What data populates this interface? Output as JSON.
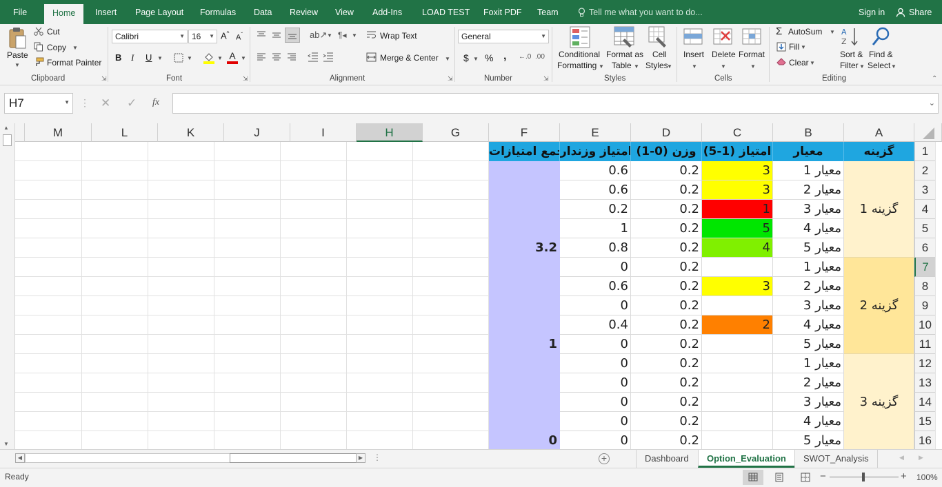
{
  "ribbon_tabs": [
    {
      "label": "File"
    },
    {
      "label": "Home"
    },
    {
      "label": "Insert"
    },
    {
      "label": "Page Layout"
    },
    {
      "label": "Formulas"
    },
    {
      "label": "Data"
    },
    {
      "label": "Review"
    },
    {
      "label": "View"
    },
    {
      "label": "Add-Ins"
    },
    {
      "label": "LOAD TEST"
    },
    {
      "label": "Foxit PDF"
    },
    {
      "label": "Team"
    }
  ],
  "tell_me": "Tell me what you want to do...",
  "sign_in": "Sign in",
  "share": "Share",
  "clipboard": {
    "paste": "Paste",
    "cut": "Cut",
    "copy": "Copy",
    "format_painter": "Format Painter",
    "label": "Clipboard"
  },
  "font": {
    "name": "Calibri",
    "size": "16",
    "bold": "B",
    "italic": "I",
    "underline": "U",
    "label": "Font"
  },
  "alignment": {
    "wrap_text": "Wrap Text",
    "merge_center": "Merge & Center",
    "label": "Alignment"
  },
  "number": {
    "format": "General",
    "currency": "$",
    "percent": "%",
    "comma": ",",
    "label": "Number"
  },
  "styles": {
    "conditional_l1": "Conditional",
    "conditional_l2": "Formatting",
    "format_table_l1": "Format as",
    "format_table_l2": "Table",
    "cell_styles_l1": "Cell",
    "cell_styles_l2": "Styles",
    "label": "Styles"
  },
  "cells": {
    "insert": "Insert",
    "delete": "Delete",
    "format": "Format",
    "label": "Cells"
  },
  "editing": {
    "autosum": "AutoSum",
    "fill": "Fill",
    "clear": "Clear",
    "sort_l1": "Sort &",
    "sort_l2": "Filter",
    "find_l1": "Find &",
    "find_l2": "Select",
    "label": "Editing"
  },
  "formula_bar": {
    "name_box": "H7",
    "fx": "fx",
    "content": ""
  },
  "columns": [
    "M",
    "L",
    "K",
    "J",
    "I",
    "H",
    "G",
    "F",
    "E",
    "D",
    "C",
    "B",
    "A"
  ],
  "selected_column": "H",
  "rows": [
    "1",
    "2",
    "3",
    "4",
    "5",
    "6",
    "7",
    "8",
    "9",
    "10",
    "11",
    "12",
    "13",
    "14",
    "15",
    "16"
  ],
  "selected_row": "7",
  "headers": {
    "a": "گزینه",
    "b": "معیار",
    "c": "امتیاز (1-5)",
    "d": "وزن (0-1)",
    "e": "امتیاز وزندار",
    "f": "جمع امتیازات"
  },
  "options": [
    "گزینه 1",
    "گزینه 2",
    "گزینه 3"
  ],
  "table_rows": [
    {
      "b": "معیار 1",
      "c": "3",
      "d": "0.2",
      "e": "0.6",
      "fill": "#ffff00"
    },
    {
      "b": "معیار 2",
      "c": "3",
      "d": "0.2",
      "e": "0.6",
      "fill": "#ffff00"
    },
    {
      "b": "معیار 3",
      "c": "1",
      "d": "0.2",
      "e": "0.2",
      "fill": "#ff0000"
    },
    {
      "b": "معیار 4",
      "c": "5",
      "d": "0.2",
      "e": "1",
      "fill": "#00e600"
    },
    {
      "b": "معیار 5",
      "c": "4",
      "d": "0.2",
      "e": "0.8",
      "fill": "#80f000"
    },
    {
      "b": "معیار 1",
      "c": "",
      "d": "0.2",
      "e": "0",
      "fill": ""
    },
    {
      "b": "معیار 2",
      "c": "3",
      "d": "0.2",
      "e": "0.6",
      "fill": "#ffff00"
    },
    {
      "b": "معیار 3",
      "c": "",
      "d": "0.2",
      "e": "0",
      "fill": ""
    },
    {
      "b": "معیار 4",
      "c": "2",
      "d": "0.2",
      "e": "0.4",
      "fill": "#ff8000"
    },
    {
      "b": "معیار 5",
      "c": "",
      "d": "0.2",
      "e": "0",
      "fill": ""
    },
    {
      "b": "معیار 1",
      "c": "",
      "d": "0.2",
      "e": "0",
      "fill": ""
    },
    {
      "b": "معیار 2",
      "c": "",
      "d": "0.2",
      "e": "0",
      "fill": ""
    },
    {
      "b": "معیار 3",
      "c": "",
      "d": "0.2",
      "e": "0",
      "fill": ""
    },
    {
      "b": "معیار 4",
      "c": "",
      "d": "0.2",
      "e": "0",
      "fill": ""
    },
    {
      "b": "معیار 5",
      "c": "",
      "d": "0.2",
      "e": "0",
      "fill": ""
    }
  ],
  "totals": [
    "3.2",
    "1",
    "0"
  ],
  "sheet_tabs": [
    {
      "label": "Dashboard"
    },
    {
      "label": "Option_Evaluation"
    },
    {
      "label": "SWOT_Analysis"
    }
  ],
  "active_sheet": "Option_Evaluation",
  "status": {
    "ready": "Ready",
    "zoom": "100%",
    "zoom_plus": "+",
    "zoom_minus": "−"
  },
  "colors": {
    "excel_green": "#217346",
    "header_blue": "#1fa6e0",
    "total_fill": "#c5c5ff",
    "option1_fill": "#fff2cc",
    "option2_fill": "#ffe699",
    "option3_fill": "#fff2cc"
  }
}
